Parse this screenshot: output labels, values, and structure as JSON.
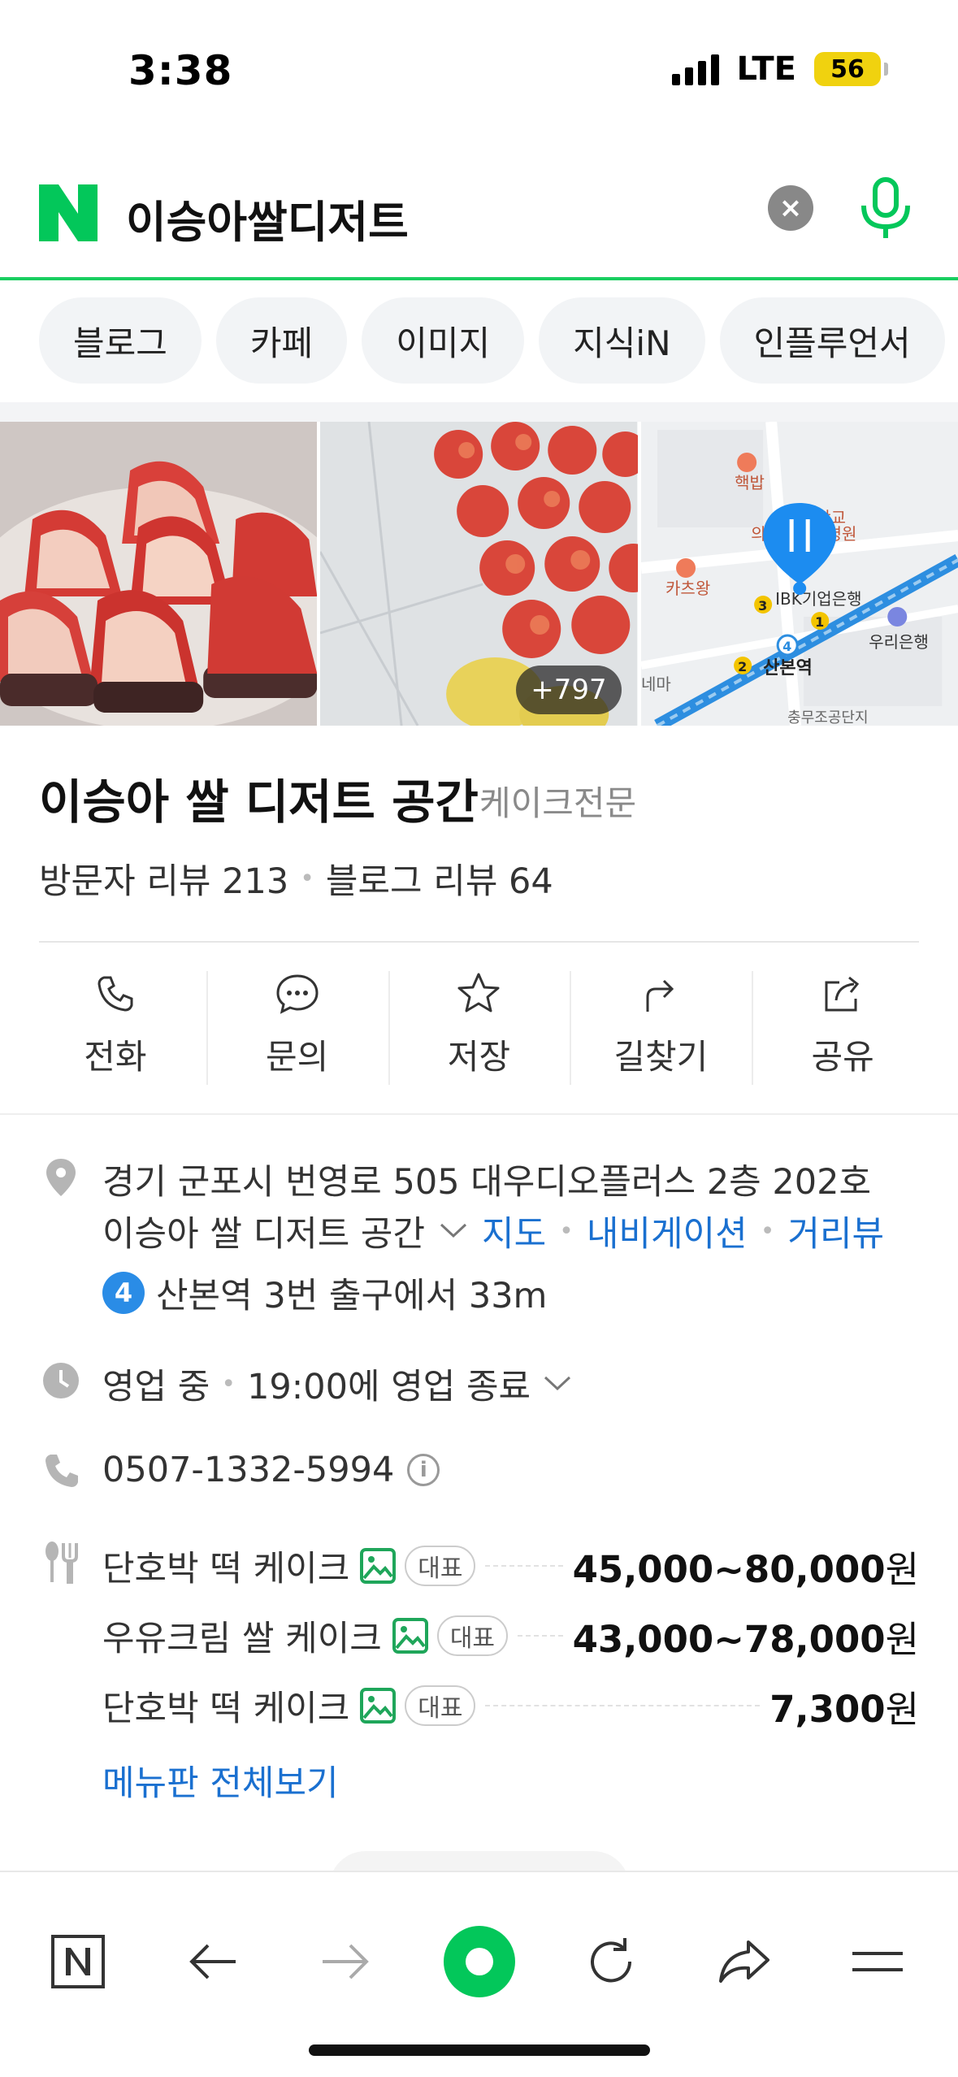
{
  "status_bar": {
    "time": "3:38",
    "network": "LTE",
    "battery": "56"
  },
  "search": {
    "query": "이승아쌀디저트"
  },
  "tabs": [
    "블로그",
    "카페",
    "이미지",
    "지식iN",
    "인플루언서"
  ],
  "photos": {
    "more_count": "+797"
  },
  "map": {
    "labels": [
      "핵밥",
      "의고",
      "학교",
      "본병원",
      "카츠왕",
      "IBK기업은행",
      "우리은행",
      "산본역",
      "네마",
      "충무조공단지"
    ],
    "line_numbers": [
      "3",
      "1",
      "4",
      "2"
    ]
  },
  "place": {
    "name": "이승아 쌀 디저트 공간",
    "category": "케이크전문",
    "visitor_reviews": "방문자 리뷰 213",
    "blog_reviews": "블로그 리뷰 64"
  },
  "actions": [
    {
      "label": "전화",
      "icon": "phone-icon"
    },
    {
      "label": "문의",
      "icon": "chat-icon"
    },
    {
      "label": "저장",
      "icon": "star-icon"
    },
    {
      "label": "길찾기",
      "icon": "directions-icon"
    },
    {
      "label": "공유",
      "icon": "share-icon"
    }
  ],
  "address": {
    "line1": "경기 군포시 번영로 505 대우디오플러스 2층 202호",
    "line2": "이승아 쌀 디저트 공간",
    "links": [
      "지도",
      "내비게이션",
      "거리뷰"
    ]
  },
  "subway": {
    "line": "4",
    "text": "산본역 3번 출구에서 33m",
    "color": "#2a8ce6"
  },
  "hours": {
    "status": "영업 중",
    "detail": "19:00에 영업 종료"
  },
  "phone": {
    "number": "0507-1332-5994"
  },
  "menu": {
    "items": [
      {
        "name": "단호박 떡 케이크",
        "badge": "대표",
        "price": "45,000~80,000",
        "unit": "원"
      },
      {
        "name": "우유크림 쌀 케이크",
        "badge": "대표",
        "price": "43,000~78,000",
        "unit": "원"
      },
      {
        "name": "단호박 떡 케이크",
        "badge": "대표",
        "price": "7,300",
        "unit": "원"
      }
    ],
    "view_all": "메뉴판 전체보기"
  },
  "colors": {
    "naver_green": "#03c75a",
    "link_blue": "#1a70d0",
    "border_green": "#19ce60"
  }
}
